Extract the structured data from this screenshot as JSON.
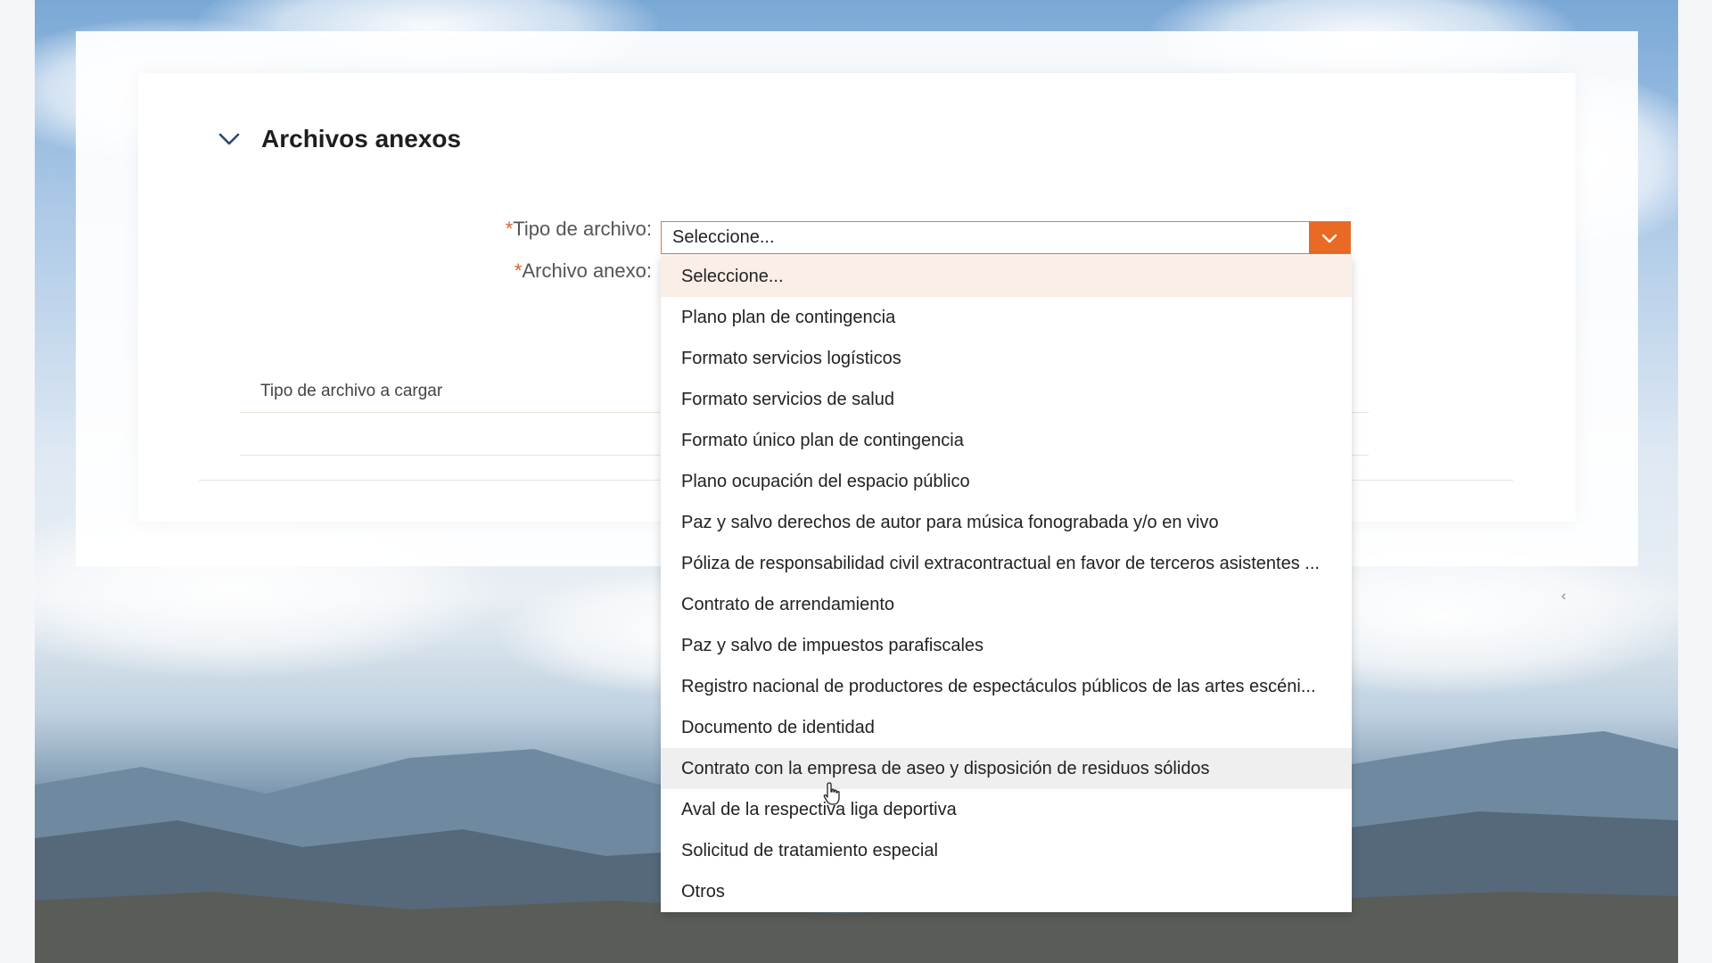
{
  "section": {
    "title": "Archivos anexos",
    "collapse_icon": "chevron-down-icon"
  },
  "form": {
    "tipo_label_req": "*",
    "tipo_label": "Tipo de archivo:",
    "anexo_label_req": "*",
    "anexo_label": "Archivo anexo:",
    "select_value": "Seleccione...",
    "select_icon": "chevron-down-icon",
    "table_header": "Tipo de archivo a cargar"
  },
  "dropdown": {
    "selected_index": 0,
    "hover_index": 12,
    "options": [
      "Seleccione...",
      "Plano plan de contingencia",
      "Formato servicios logísticos",
      "Formato servicios de salud",
      "Formato único plan de contingencia",
      "Plano ocupación del espacio público",
      "Paz y salvo derechos de autor para música fonograbada y/o en vivo",
      "Póliza de responsabilidad civil extracontractual en favor de terceros asistentes ...",
      "Contrato de arrendamiento",
      "Paz y salvo de impuestos parafiscales",
      "Registro nacional de productores de espectáculos públicos de las artes escéni...",
      "Documento de identidad",
      "Contrato con la empresa de aseo y disposición de residuos sólidos",
      "Aval de la respectiva liga deportiva",
      "Solicitud de tratamiento especial",
      "Otros"
    ]
  },
  "colors": {
    "accent": "#e86a24",
    "selected_bg": "#fbeee6",
    "hover_bg": "#efefef"
  },
  "decor": {
    "background_caret": "‹",
    "cursor_icon": "hand-pointer-icon"
  }
}
